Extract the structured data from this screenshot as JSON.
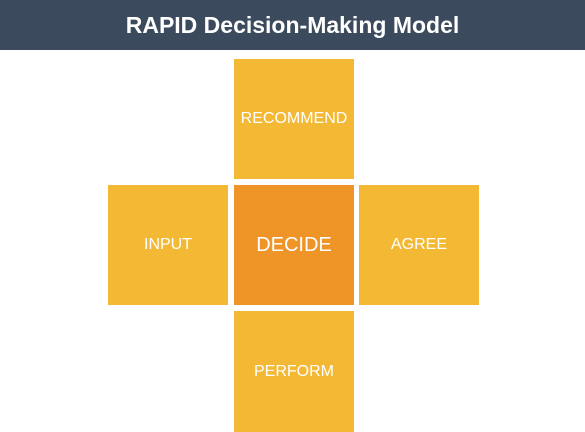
{
  "header": {
    "title": "RAPID Decision-Making Model"
  },
  "diagram": {
    "recommend": "RECOMMEND",
    "input": "INPUT",
    "decide": "DECIDE",
    "agree": "AGREE",
    "perform": "PERFORM"
  },
  "colors": {
    "header_background": "#3b4a5c",
    "role_box": "#f3b935",
    "decide_box": "#ef9427",
    "text": "#ffffff"
  }
}
